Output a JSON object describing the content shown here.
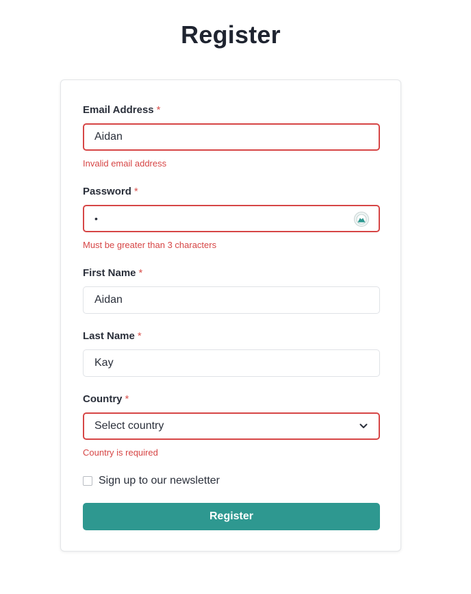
{
  "page": {
    "title": "Register"
  },
  "form": {
    "email": {
      "label": "Email Address",
      "required_mark": "*",
      "value": "Aidan",
      "error": "Invalid email address"
    },
    "password": {
      "label": "Password",
      "required_mark": "*",
      "masked_value": "•",
      "error": "Must be greater than 3 characters",
      "icon": "password-manager-icon"
    },
    "first_name": {
      "label": "First Name",
      "required_mark": "*",
      "value": "Aidan"
    },
    "last_name": {
      "label": "Last Name",
      "required_mark": "*",
      "value": "Kay"
    },
    "country": {
      "label": "Country",
      "required_mark": "*",
      "selected": "Select country",
      "error": "Country is required",
      "icon": "chevron-down-icon"
    },
    "newsletter": {
      "label": "Sign up to our newsletter",
      "checked": false
    },
    "submit_label": "Register"
  },
  "colors": {
    "accent": "#2e9890",
    "error": "#d64545",
    "text": "#2a2f3a",
    "border": "#dfe2e6"
  }
}
